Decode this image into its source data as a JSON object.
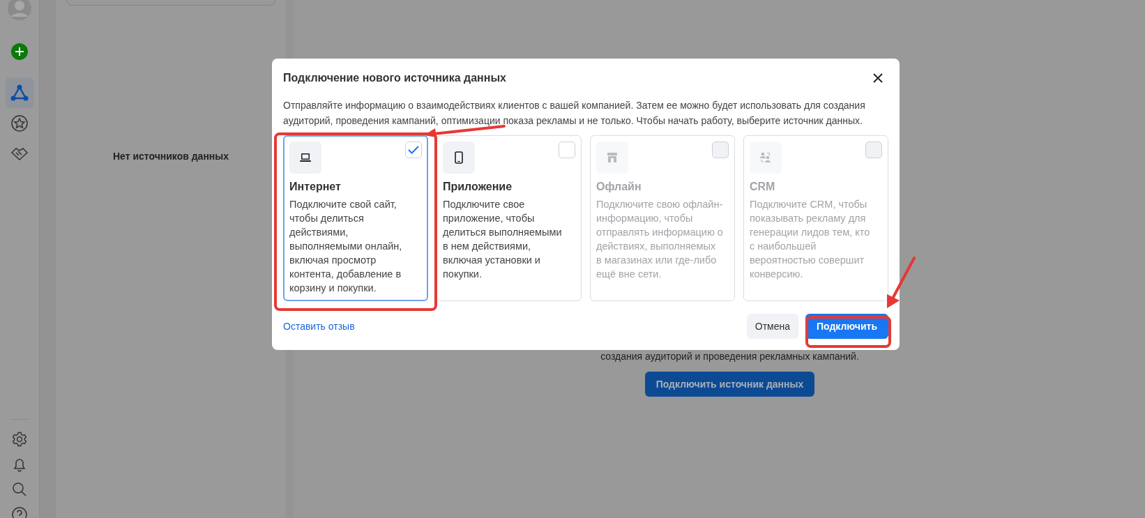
{
  "sidebar": {
    "items": [
      {
        "kind": "avatar",
        "selected": false
      },
      {
        "kind": "add",
        "selected": false
      },
      {
        "kind": "network",
        "selected": true
      },
      {
        "kind": "star",
        "selected": false
      },
      {
        "kind": "handshake",
        "selected": false
      }
    ],
    "bottom_items": [
      {
        "kind": "gear",
        "selected": false
      },
      {
        "kind": "bell",
        "selected": false
      },
      {
        "kind": "search",
        "selected": false
      },
      {
        "kind": "help",
        "selected": false
      }
    ]
  },
  "panel": {
    "empty_message": "Нет источников данных"
  },
  "main": {
    "text": "создания аудиторий и проведения рекламных кампаний.",
    "button": "Подключить источник данных"
  },
  "dialog": {
    "title": "Подключение нового источника данных",
    "description": "Отправляйте информацию о взаимодействиях клиентов с вашей компанией. Затем ее можно будет использовать для создания аудиторий, проведения кампаний, оптимизации показа рекламы и не только. Чтобы начать работу, выберите источник данных.",
    "sources": [
      {
        "kind": "laptop",
        "title": "Интернет",
        "description": "Подключите свой сайт, чтобы делиться действиями, выполняемыми онлайн, включая просмотр контента, добавление в корзину и покупки.",
        "selected": true,
        "disabled": false
      },
      {
        "kind": "phone",
        "title": "Приложение",
        "description": "Подключите свое приложение, чтобы делиться выполняемыми в нем действиями, включая установки и покупки.",
        "selected": false,
        "disabled": false
      },
      {
        "kind": "store",
        "title": "Офлайн",
        "description": "Подключите свою офлайн-информацию, чтобы отправлять информацию о действиях, выполняемых в магазинах или где-либо ещё вне сети.",
        "selected": false,
        "disabled": true
      },
      {
        "kind": "people",
        "title": "CRM",
        "description": "Подключите CRM, чтобы показывать рекламу для генерации лидов тем, кто с наибольшей вероятностью совершит конверсию.",
        "selected": false,
        "disabled": true
      }
    ],
    "feedback_link": "Оставить отзыв",
    "cancel_button": "Отмена",
    "connect_button": "Подключить"
  }
}
